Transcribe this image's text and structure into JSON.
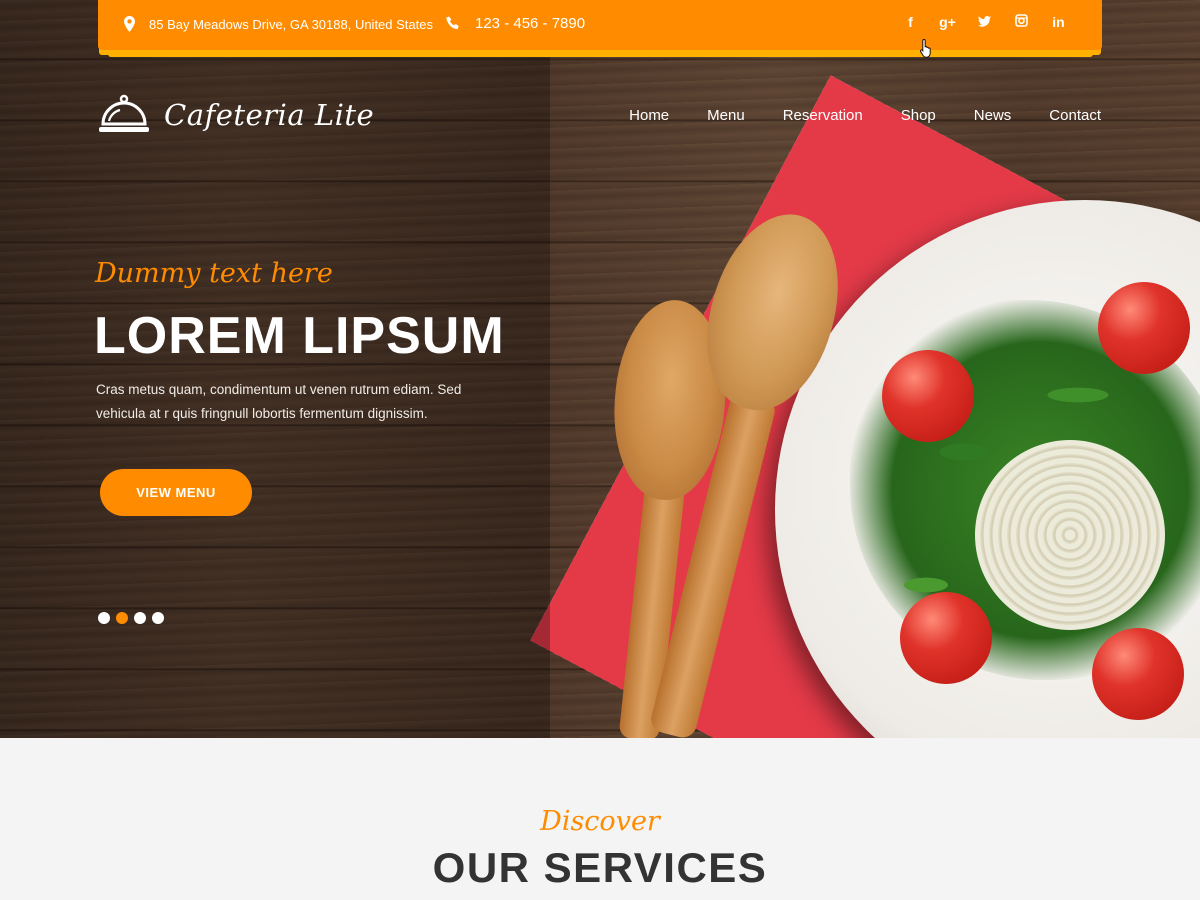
{
  "topbar": {
    "address": "85 Bay Meadows Drive, GA 30188, United States",
    "phone": "123 - 456 - 7890",
    "social": [
      {
        "name": "facebook-icon",
        "glyph": "f"
      },
      {
        "name": "google-plus-icon",
        "glyph": "g+"
      },
      {
        "name": "twitter-icon",
        "glyph": "🐦"
      },
      {
        "name": "instagram-icon",
        "glyph": "◙"
      },
      {
        "name": "linkedin-icon",
        "glyph": "in"
      }
    ]
  },
  "brand": {
    "name": "Cafeteria Lite",
    "logo_icon": "service-bell-icon"
  },
  "nav": {
    "items": [
      "Home",
      "Menu",
      "Reservation",
      "Shop",
      "News",
      "Contact"
    ]
  },
  "hero": {
    "kicker": "Dummy text here",
    "title": "LOREM LIPSUM",
    "description": "Cras metus quam, condimentum ut venen rutrum ediam. Sed vehicula at r quis fringnull lobortis fermentum dignissim.",
    "button_label": "VIEW MENU",
    "slides": 4,
    "active_slide": 2
  },
  "services": {
    "kicker": "Discover",
    "title": "OUR SERVICES"
  },
  "colors": {
    "accent": "#ff8c00",
    "topbar_underline": "#ffb300",
    "heading_dark": "#333333",
    "section_bg": "#f4f4f4"
  }
}
